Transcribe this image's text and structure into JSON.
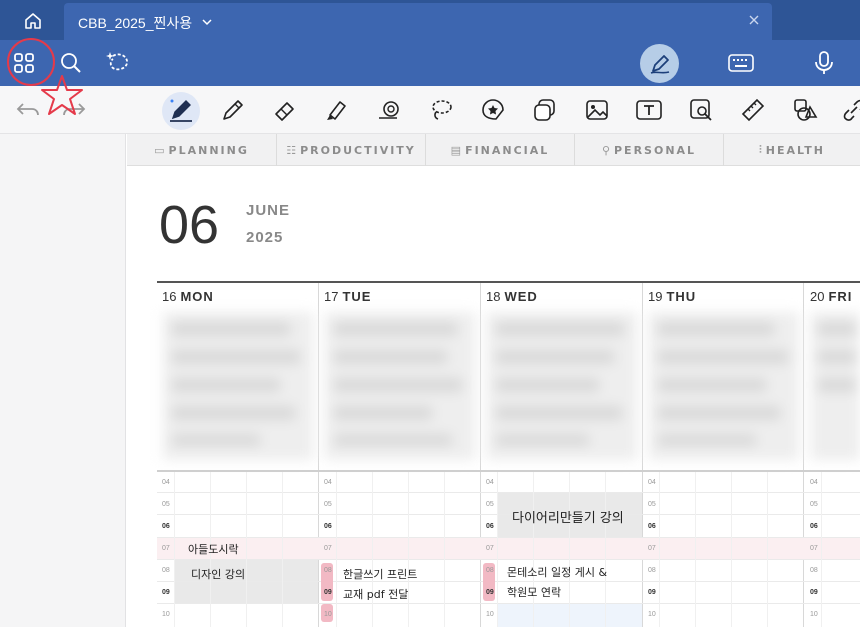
{
  "titlebar": {
    "tab_title": "CBB_2025_찐사용"
  },
  "planner": {
    "tabs": [
      {
        "label": "PLANNING",
        "glyph": "▭"
      },
      {
        "label": "PRODUCTIVITY",
        "glyph": "☷"
      },
      {
        "label": "FINANCIAL",
        "glyph": "▤"
      },
      {
        "label": "PERSONAL",
        "glyph": "⚲"
      },
      {
        "label": "HEALTH",
        "glyph": "⫶"
      }
    ],
    "day_number": "06",
    "month": "JUNE",
    "year": "2025",
    "days": [
      {
        "num": "16",
        "name": "MON"
      },
      {
        "num": "17",
        "name": "TUE"
      },
      {
        "num": "18",
        "name": "WED"
      },
      {
        "num": "19",
        "name": "THU"
      },
      {
        "num": "20",
        "name": "FRI"
      }
    ],
    "hours": [
      "04",
      "05",
      "06",
      "07",
      "08",
      "09",
      "10"
    ],
    "notes": {
      "mon_1": "아들도시락",
      "mon_2": "디자인 강의",
      "tue_1": "한글쓰기 프린트",
      "tue_2": "교재 pdf 전달",
      "wed_1": "다이어리만들기 강의",
      "wed_2": "몬테소리 일정 게시 &",
      "wed_3": "학원모 연락"
    }
  },
  "colors": {
    "titlebar": "#2e5596",
    "toolbar": "#3d66b0",
    "annotation_red": "#e53a4a",
    "pink_band": "#fbeff1"
  },
  "icons": [
    "home-icon",
    "chevron-down-icon",
    "close-icon",
    "grid-icon",
    "search-icon",
    "lasso-sparkle-icon",
    "pen-mode-icon",
    "keyboard-icon",
    "microphone-icon",
    "undo-icon",
    "redo-icon",
    "pen-tool-icon",
    "pencil-icon",
    "eraser-icon",
    "highlighter-icon",
    "shape-icon",
    "lasso-icon",
    "sticker-icon",
    "elements-icon",
    "image-icon",
    "text-icon",
    "image-search-icon",
    "ruler-icon",
    "shapes-icon",
    "link-icon"
  ]
}
